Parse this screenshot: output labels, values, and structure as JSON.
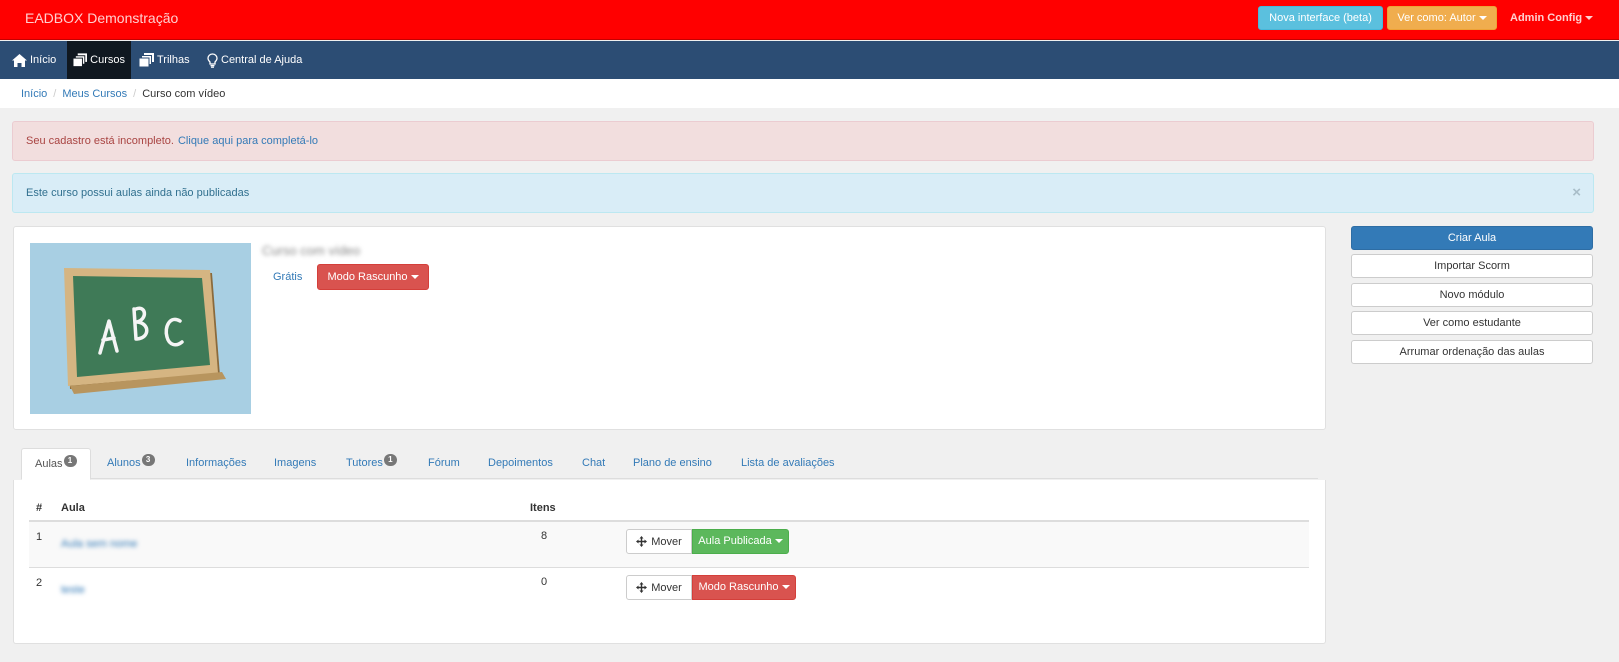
{
  "topbar": {
    "brand": "EADBOX Demonstração",
    "beta_label": "Nova interface (beta)",
    "view_as_label": "Ver como: Autor",
    "admin_label": "Admin Config"
  },
  "nav": {
    "items": [
      {
        "label": "Início",
        "icon": "home-icon"
      },
      {
        "label": "Cursos",
        "icon": "courses-icon"
      },
      {
        "label": "Trilhas",
        "icon": "trails-icon"
      },
      {
        "label": "Central de Ajuda",
        "icon": "lightbulb-icon"
      }
    ]
  },
  "breadcrumb": [
    "Início",
    "Meus Cursos",
    "Curso com vídeo"
  ],
  "alerts": {
    "incomplete_text": "Seu cadastro está incompleto.",
    "incomplete_link": "Clique aqui para completá-lo",
    "unpublished_text": "Este curso possui aulas ainda não publicadas",
    "close": "×"
  },
  "course": {
    "title": "Curso com vídeo",
    "price": "Grátis",
    "status": "Modo Rascunho",
    "thumbnail_letters": [
      "A",
      "B",
      "C"
    ]
  },
  "actions": [
    "Criar Aula",
    "Importar Scorm",
    "Novo módulo",
    "Ver como estudante",
    "Arrumar ordenação das aulas"
  ],
  "tabs": [
    {
      "label": "Aulas",
      "badge": "1"
    },
    {
      "label": "Alunos",
      "badge": "3"
    },
    {
      "label": "Informações",
      "badge": ""
    },
    {
      "label": "Imagens",
      "badge": ""
    },
    {
      "label": "Tutores",
      "badge": "1"
    },
    {
      "label": "Fórum",
      "badge": ""
    },
    {
      "label": "Depoimentos",
      "badge": ""
    },
    {
      "label": "Chat",
      "badge": ""
    },
    {
      "label": "Plano de ensino",
      "badge": ""
    },
    {
      "label": "Lista de avaliações",
      "badge": ""
    }
  ],
  "table": {
    "headers": [
      "#",
      "Aula",
      "Itens"
    ],
    "rows": [
      {
        "num": "1",
        "name": "Aula sem nome",
        "items": "8",
        "move": "Mover",
        "status": "Aula Publicada"
      },
      {
        "num": "2",
        "name": "teste",
        "items": "0",
        "move": "Mover",
        "status": "Modo Rascunho"
      }
    ]
  },
  "colors": {
    "topbar": "#ff0000",
    "navbar": "#2c4d74",
    "primary": "#337ab7",
    "danger": "#d9534f",
    "success": "#5cb85c",
    "info": "#5bc0de",
    "warning": "#f0ad4e"
  }
}
